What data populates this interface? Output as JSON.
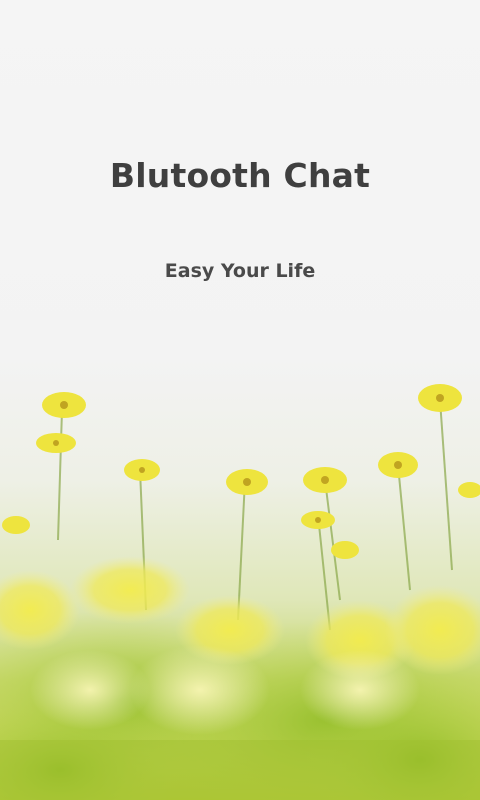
{
  "splash": {
    "title": "Blutooth Chat",
    "subtitle": "Easy Your Life",
    "background_image": "yellow-cosmos-flowers-field",
    "colors": {
      "text_dark": "#3f3f3f",
      "text_sub": "#4a4a4a",
      "flower_yellow": "#e8e23a",
      "leaf_green": "#8fb52a"
    }
  }
}
